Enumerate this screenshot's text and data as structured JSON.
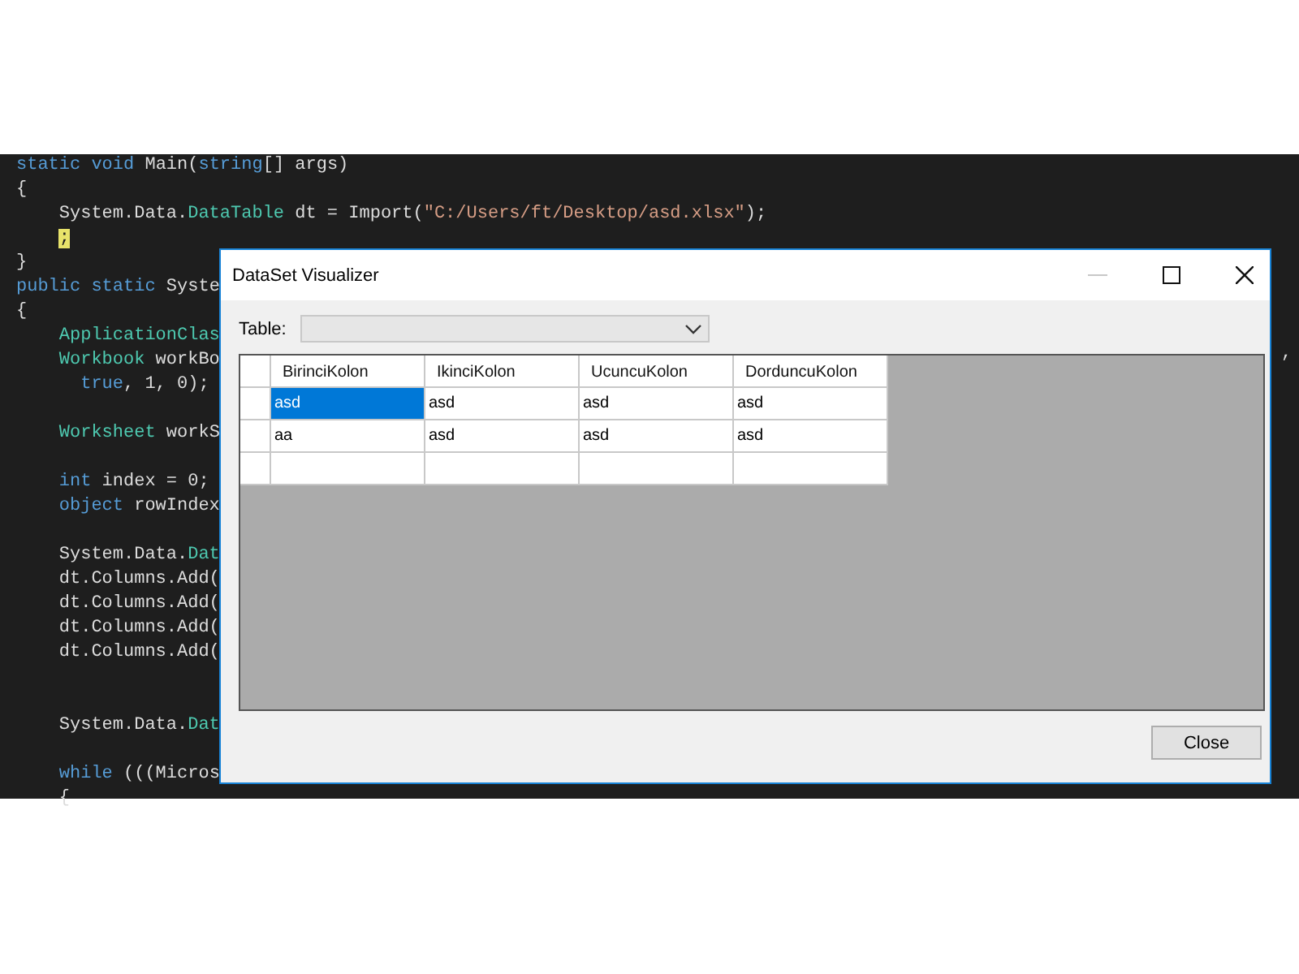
{
  "editor": {
    "lines": [
      {
        "kind": "code",
        "segments": [
          {
            "kind": "keyword",
            "text": "static void "
          },
          {
            "kind": "plain",
            "text": "Main("
          },
          {
            "kind": "keyword",
            "text": "string"
          },
          {
            "kind": "plain",
            "text": "[] args)"
          }
        ]
      },
      {
        "kind": "block",
        "segments": [
          {
            "kind": "plain",
            "text": "{"
          }
        ],
        "children": [
          {
            "kind": "code",
            "segments": [
              {
                "kind": "plain",
                "text": "System.Data."
              },
              {
                "kind": "type",
                "text": "DataTable"
              },
              {
                "kind": "plain",
                "text": " dt = Import("
              },
              {
                "kind": "string",
                "text": "\"C:/Users/ft/Desktop/asd.xlsx\""
              },
              {
                "kind": "plain",
                "text": ");"
              }
            ]
          },
          {
            "kind": "code",
            "segments": [
              {
                "kind": "highlight",
                "text": ";"
              }
            ]
          }
        ]
      },
      {
        "kind": "code",
        "segments": [
          {
            "kind": "plain",
            "text": "}"
          }
        ]
      },
      {
        "kind": "code",
        "segments": [
          {
            "kind": "keyword",
            "text": "public static "
          },
          {
            "kind": "plain",
            "text": "Syste"
          }
        ]
      },
      {
        "kind": "block",
        "segments": [
          {
            "kind": "plain",
            "text": "{"
          }
        ],
        "children": [
          {
            "kind": "code",
            "segments": [
              {
                "kind": "type",
                "text": "ApplicationClas"
              }
            ]
          },
          {
            "kind": "code",
            "segments": [
              {
                "kind": "type",
                "text": "Workbook"
              },
              {
                "kind": "plain",
                "text": " workBo"
              }
            ],
            "children": [
              {
                "kind": "code",
                "segments": [
                  {
                    "kind": "keyword",
                    "text": "true"
                  },
                  {
                    "kind": "plain",
                    "text": ", 1, 0);"
                  }
                ]
              }
            ]
          },
          {
            "kind": "blank"
          },
          {
            "kind": "code",
            "segments": [
              {
                "kind": "type",
                "text": "Worksheet"
              },
              {
                "kind": "plain",
                "text": " workS"
              }
            ]
          },
          {
            "kind": "blank"
          },
          {
            "kind": "code",
            "segments": [
              {
                "kind": "keyword",
                "text": "int"
              },
              {
                "kind": "plain",
                "text": " index = 0;"
              }
            ]
          },
          {
            "kind": "code",
            "segments": [
              {
                "kind": "keyword",
                "text": "object"
              },
              {
                "kind": "plain",
                "text": " rowIndex"
              }
            ]
          },
          {
            "kind": "blank"
          },
          {
            "kind": "code",
            "segments": [
              {
                "kind": "plain",
                "text": "System.Data."
              },
              {
                "kind": "type",
                "text": "Dat"
              }
            ]
          },
          {
            "kind": "code",
            "segments": [
              {
                "kind": "plain",
                "text": "dt.Columns.Add("
              }
            ]
          },
          {
            "kind": "code",
            "segments": [
              {
                "kind": "plain",
                "text": "dt.Columns.Add("
              }
            ]
          },
          {
            "kind": "code",
            "segments": [
              {
                "kind": "plain",
                "text": "dt.Columns.Add("
              }
            ]
          },
          {
            "kind": "code",
            "segments": [
              {
                "kind": "plain",
                "text": "dt.Columns.Add("
              }
            ]
          },
          {
            "kind": "blank"
          },
          {
            "kind": "blank"
          },
          {
            "kind": "code",
            "segments": [
              {
                "kind": "plain",
                "text": "System.Data."
              },
              {
                "kind": "type",
                "text": "Dat"
              }
            ]
          },
          {
            "kind": "blank"
          },
          {
            "kind": "code",
            "segments": [
              {
                "kind": "keyword",
                "text": "while"
              },
              {
                "kind": "plain",
                "text": " (((Micros"
              }
            ]
          },
          {
            "kind": "code",
            "segments": [
              {
                "kind": "plain",
                "text": "{"
              }
            ]
          }
        ]
      }
    ],
    "right_fragment": ","
  },
  "dialog": {
    "title": "DataSet Visualizer",
    "table_label": "Table:",
    "grid": {
      "columns": [
        "BirinciKolon",
        "IkinciKolon",
        "UcuncuKolon",
        "DorduncuKolon"
      ],
      "rows": [
        {
          "cells": [
            {
              "text": "asd",
              "selected": true
            },
            {
              "text": "asd",
              "selected": false
            },
            {
              "text": "asd",
              "selected": false
            },
            {
              "text": "asd",
              "selected": false
            }
          ]
        },
        {
          "cells": [
            {
              "text": "aa",
              "selected": false
            },
            {
              "text": "asd",
              "selected": false
            },
            {
              "text": "asd",
              "selected": false
            },
            {
              "text": "asd",
              "selected": false
            }
          ]
        }
      ]
    },
    "close_button": "Close"
  }
}
